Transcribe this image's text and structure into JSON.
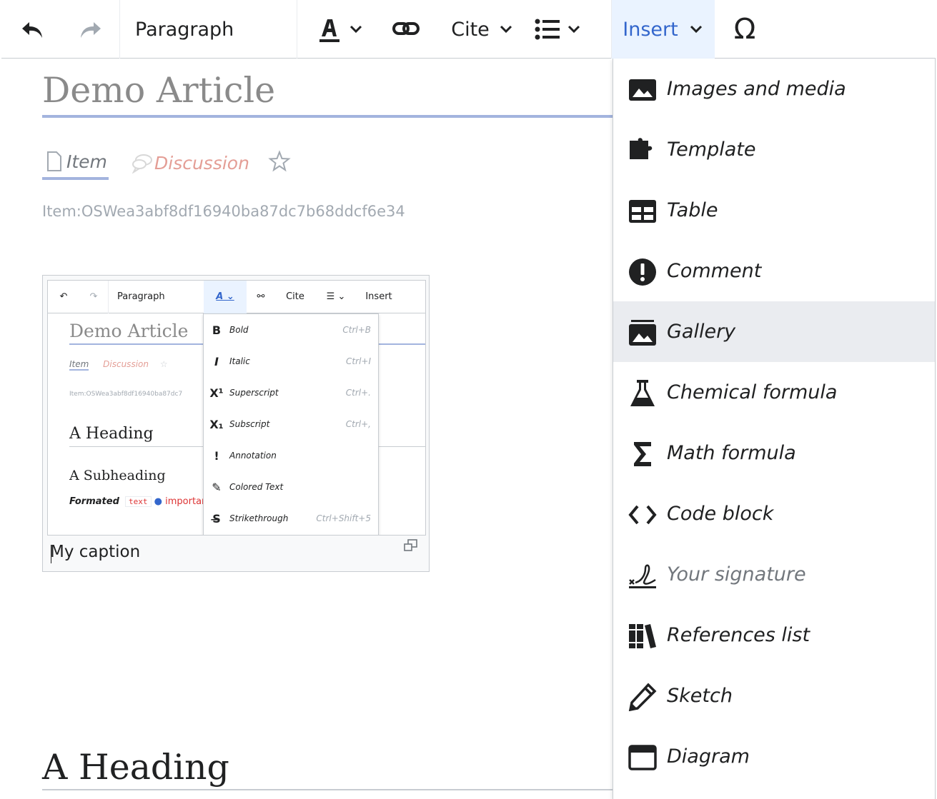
{
  "toolbar": {
    "undo_icon": "undo-icon",
    "redo_icon": "redo-icon",
    "paragraph_label": "Paragraph",
    "text_style_icon": "text-style-icon",
    "link_icon": "link-icon",
    "cite_label": "Cite",
    "list_icon": "bullet-list-icon",
    "insert_label": "Insert",
    "special_char_icon": "omega-icon"
  },
  "article": {
    "title": "Demo Article",
    "tabs": [
      {
        "label": "Item"
      },
      {
        "label": "Discussion"
      }
    ],
    "identifier": "Item:OSWea3abf8df16940ba87dc7b68ddcf6e34",
    "image_caption": "My caption",
    "heading": "A Heading"
  },
  "embedded_screenshot": {
    "toolbar": {
      "paragraph": "Paragraph",
      "cite": "Cite",
      "insert": "Insert"
    },
    "title": "Demo Article",
    "tabs": {
      "item": "Item",
      "discussion": "Discussion"
    },
    "identifier": "Item:OSWea3abf8df16940ba87dc7",
    "heading": "A Heading",
    "subheading": "A Subheading",
    "formatted": {
      "bold": "Formated",
      "code": "text",
      "important": "importar"
    },
    "menu": [
      {
        "icon": "B",
        "label": "Bold",
        "shortcut": "Ctrl+B"
      },
      {
        "icon": "I",
        "label": "Italic",
        "shortcut": "Ctrl+I"
      },
      {
        "icon": "X¹",
        "label": "Superscript",
        "shortcut": "Ctrl+."
      },
      {
        "icon": "X₁",
        "label": "Subscript",
        "shortcut": "Ctrl+,"
      },
      {
        "icon": "!",
        "label": "Annotation",
        "shortcut": ""
      },
      {
        "icon": "✎",
        "label": "Colored Text",
        "shortcut": ""
      },
      {
        "icon": "S̶",
        "label": "Strikethrough",
        "shortcut": "Ctrl+Shift+5"
      }
    ]
  },
  "insert_menu": {
    "items": [
      {
        "label": "Images and media",
        "icon": "image-icon"
      },
      {
        "label": "Template",
        "icon": "puzzle-icon"
      },
      {
        "label": "Table",
        "icon": "table-icon"
      },
      {
        "label": "Comment",
        "icon": "alert-icon"
      },
      {
        "label": "Gallery",
        "icon": "gallery-icon"
      },
      {
        "label": "Chemical formula",
        "icon": "flask-icon"
      },
      {
        "label": "Math formula",
        "icon": "sigma-icon"
      },
      {
        "label": "Code block",
        "icon": "code-icon"
      },
      {
        "label": "Your signature",
        "icon": "signature-icon"
      },
      {
        "label": "References list",
        "icon": "books-icon"
      },
      {
        "label": "Sketch",
        "icon": "pencil-icon"
      },
      {
        "label": "Diagram",
        "icon": "window-icon"
      }
    ],
    "highlighted": "Gallery",
    "disabled": [
      "Your signature"
    ]
  },
  "colors": {
    "accent": "#3366cc",
    "insert_active_bg": "#eaf3ff",
    "menu_highlight": "#eaecf0",
    "title_underline": "#a3b4de",
    "discussion_link": "#e49e96"
  }
}
